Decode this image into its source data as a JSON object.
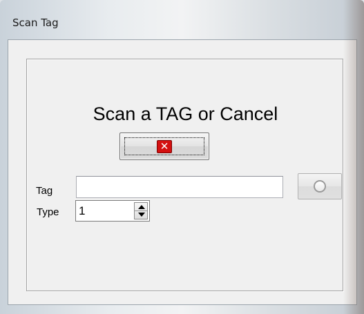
{
  "window": {
    "title": "Scan Tag"
  },
  "main": {
    "headline": "Scan a TAG or Cancel",
    "cancel_button": {
      "icon": "cancel-x-icon",
      "glyph": "✕"
    },
    "tag_label": "Tag",
    "tag_value": "",
    "tag_placeholder": "",
    "lookup_button": {
      "icon": "circle-icon"
    },
    "type_label": "Type",
    "type_value": "1"
  },
  "colors": {
    "cancel_icon": "#d41010",
    "background": "#f0f0f0"
  }
}
